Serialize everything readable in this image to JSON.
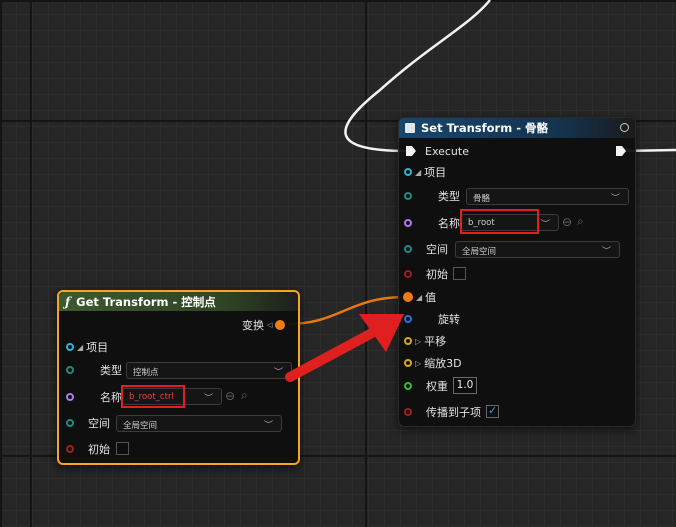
{
  "set_node": {
    "title": "Set Transform - 骨骼",
    "execute": "Execute",
    "item_label": "项目",
    "type_label": "类型",
    "type_value": "骨骼",
    "name_label": "名称",
    "name_value": "b_root",
    "space_label": "空间",
    "space_value": "全局空间",
    "initial_label": "初始",
    "value_label": "值",
    "rotation_label": "旋转",
    "translation_label": "平移",
    "scale_label": "缩放3D",
    "weight_label": "权重",
    "weight_value": "1.0",
    "propagate_label": "传播到子项"
  },
  "get_node": {
    "title": "Get Transform - 控制点",
    "func_glyph": "ƒ",
    "transform_label": "变换",
    "item_label": "项目",
    "type_label": "类型",
    "type_value": "控制点",
    "name_label": "名称",
    "name_value": "b_root_ctrl",
    "space_label": "空间",
    "space_value": "全局空间",
    "initial_label": "初始"
  },
  "colors": {
    "header_blue": "#17476e",
    "header_green": "#3d5a2f",
    "selection_orange": "#f5a623",
    "arrow_red": "#e0201f",
    "struct_orange": "#f07d13"
  }
}
